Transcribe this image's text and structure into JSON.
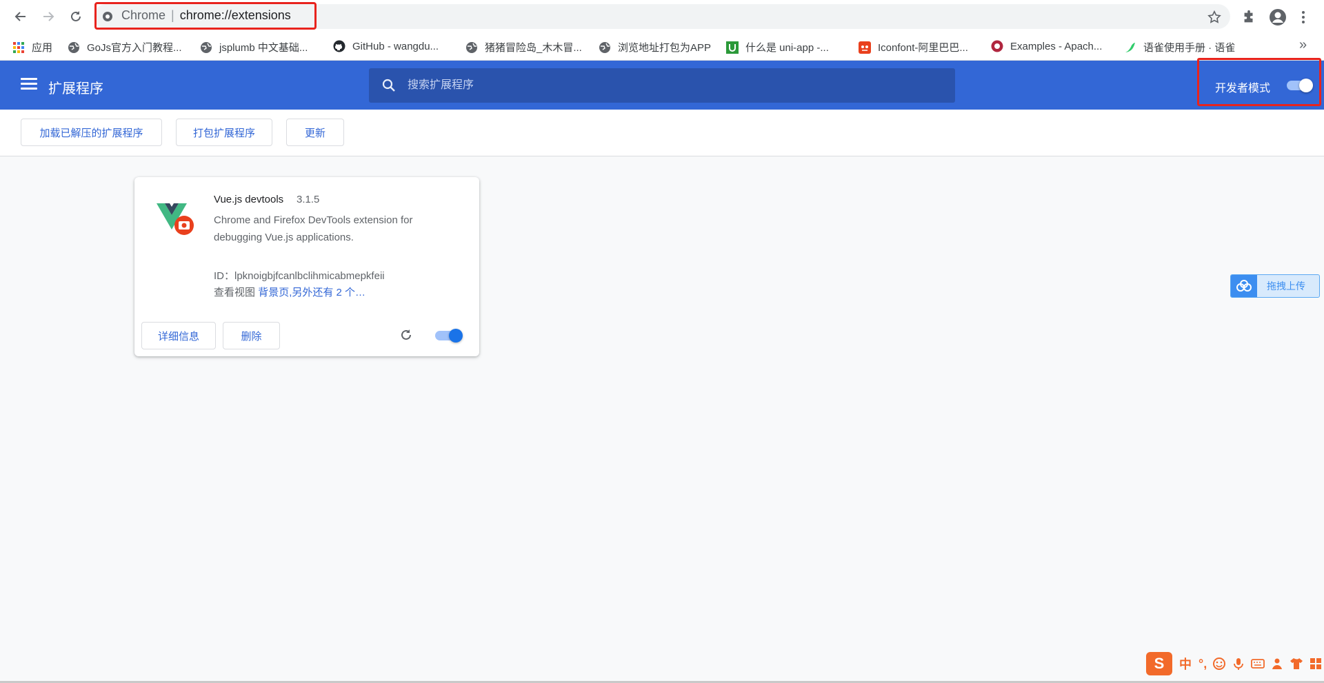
{
  "browser": {
    "url_prefix": "Chrome",
    "url_separator": "|",
    "url_path": "chrome://extensions"
  },
  "bookmarks": [
    {
      "label": "应用",
      "icon": "apps-grid-icon"
    },
    {
      "label": "GoJs官方入门教程...",
      "icon": "globe-icon"
    },
    {
      "label": "jsplumb 中文基础...",
      "icon": "globe-icon"
    },
    {
      "label": "GitHub - wangdu...",
      "icon": "github-icon"
    },
    {
      "label": "猪猪冒险岛_木木冒...",
      "icon": "globe-icon"
    },
    {
      "label": "浏览地址打包为APP",
      "icon": "globe-icon"
    },
    {
      "label": "什么是 uni-app -...",
      "icon": "uniapp-icon"
    },
    {
      "label": "Iconfont-阿里巴巴...",
      "icon": "iconfont-icon"
    },
    {
      "label": "Examples - Apach...",
      "icon": "apache-icon"
    },
    {
      "label": "语雀使用手册 · 语雀",
      "icon": "yuque-icon"
    }
  ],
  "bookmarks_more": "»",
  "header": {
    "title": "扩展程序",
    "search_placeholder": "搜索扩展程序",
    "dev_mode_label": "开发者模式",
    "dev_mode_on": true
  },
  "actions": {
    "load_unpacked": "加载已解压的扩展程序",
    "pack": "打包扩展程序",
    "update": "更新"
  },
  "extension": {
    "name": "Vue.js devtools",
    "version": "3.1.5",
    "description": "Chrome and Firefox DevTools extension for debugging Vue.js applications.",
    "id_line": "ID：lpknoigbjfcanlbclihmicabmepkfeii",
    "views_label": "查看视图",
    "views_link": "背景页,另外还有 2 个…",
    "details_button": "详细信息",
    "remove_button": "删除",
    "enabled": true
  },
  "upload_widget": {
    "label": "拖拽上传"
  },
  "ime": {
    "logo": "S",
    "mode": "中",
    "punct": "°,"
  },
  "colors": {
    "header_blue": "#3367d6",
    "highlight_red": "#e8231d",
    "link_blue": "#3367d6"
  }
}
